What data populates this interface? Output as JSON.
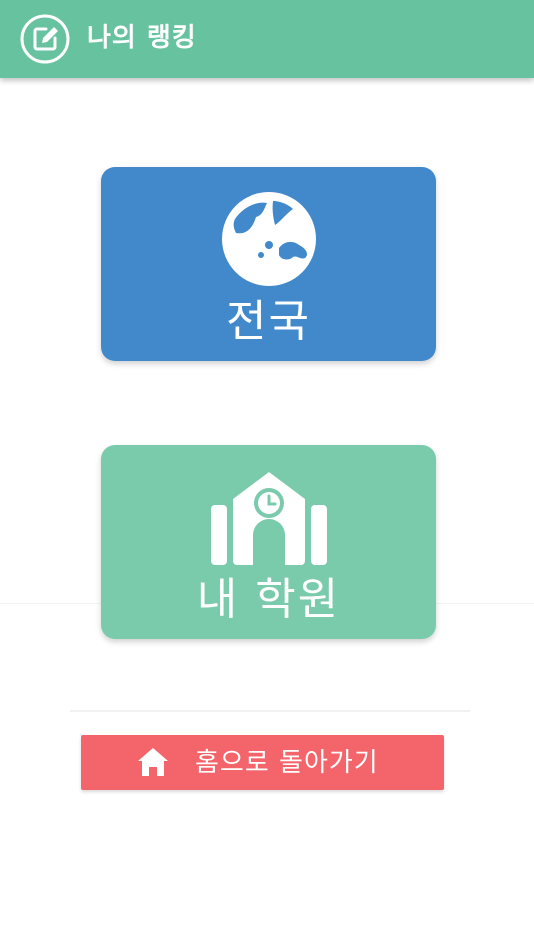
{
  "app_bar": {
    "title": "나의 랭킹",
    "icon": "edit-icon",
    "background_color": "#66c29f"
  },
  "cards": [
    {
      "label": "전국",
      "icon": "globe-icon",
      "color": "#4189cb"
    },
    {
      "label": "내 학원",
      "icon": "school-clock-icon",
      "color": "#7acbab"
    }
  ],
  "home_button": {
    "label": "홈으로 돌아가기",
    "icon": "home-icon",
    "color": "#f3656a"
  }
}
